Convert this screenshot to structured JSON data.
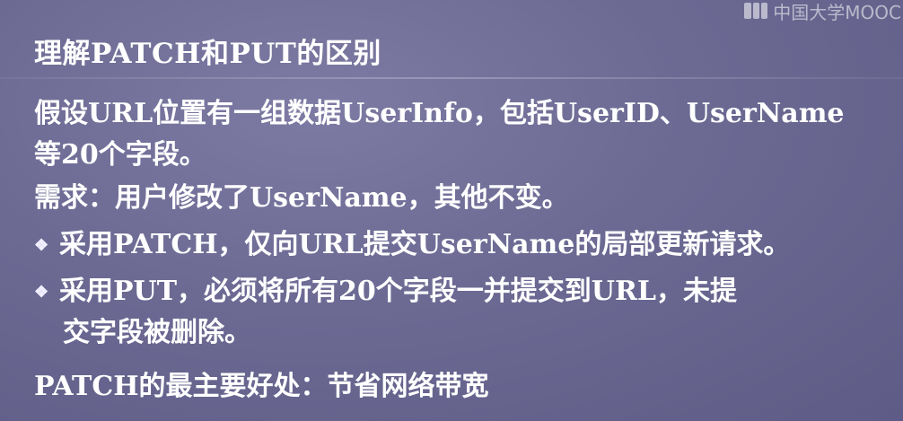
{
  "watermark": {
    "text": "中国大学MOOC",
    "logo_icon": "mooc-logo-icon"
  },
  "title": "理解PATCH和PUT的区别",
  "paragraphs": {
    "p1_line1": "假设URL位置有一组数据UserInfo，包括UserID、UserName",
    "p1_line2": "等20个字段。",
    "p2": "需求：用户修改了UserName，其他不变。"
  },
  "bullets": {
    "icon": "diamond-bullet-icon",
    "symbol": "❖",
    "b1": "采用PATCH，仅向URL提交UserName的局部更新请求。",
    "b2_line1": "采用PUT，必须将所有20个字段一并提交到URL，未提",
    "b2_line2": "交字段被删除。"
  },
  "conclusion": "PATCH的最主要好处：节省网络带宽"
}
